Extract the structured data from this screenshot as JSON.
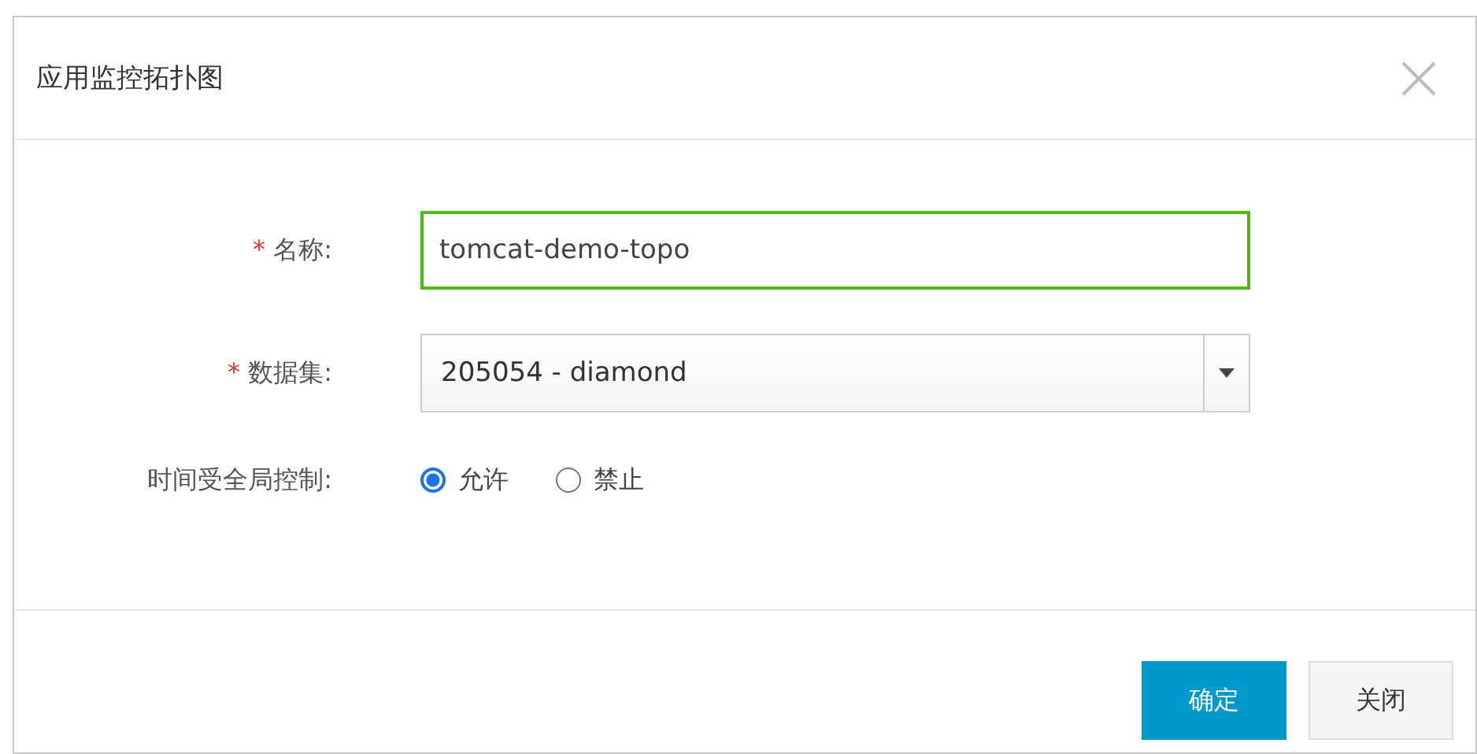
{
  "dialog": {
    "title": "应用监控拓扑图"
  },
  "fields": [
    {
      "kind": "text",
      "label": "名称:",
      "required_mark": "*",
      "value": "tomcat-demo-topo"
    },
    {
      "kind": "select",
      "label": "数据集:",
      "required_mark": "*",
      "value": "205054 - diamond"
    },
    {
      "kind": "radio",
      "label": "时间受全局控制:",
      "options": [
        {
          "label": "允许",
          "selected": true
        },
        {
          "label": "禁止",
          "selected": false
        }
      ]
    }
  ],
  "buttons": [
    {
      "label": "确定",
      "kind": "primary"
    },
    {
      "label": "关闭",
      "kind": "default"
    }
  ]
}
